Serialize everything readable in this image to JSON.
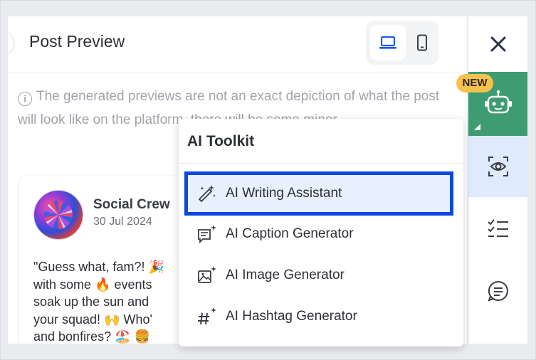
{
  "panel": {
    "title": "Post Preview",
    "notice": "The generated previews are not an exact depiction of what the post will look like on the platform, there will be some minor"
  },
  "post": {
    "account_name": "Social Crew",
    "date": "30 Jul 2024",
    "lines": [
      "\"Guess what, fam?! 🎉",
      "with some 🔥 events",
      "soak up the sun and",
      "your squad! 🙌 Who'",
      "and bonfires? 🏖️ 🍔"
    ]
  },
  "sidebar": {
    "badge": "NEW"
  },
  "menu": {
    "title": "AI Toolkit",
    "items": [
      {
        "label": "AI Writing Assistant",
        "icon": "magic-wand-icon",
        "active": true
      },
      {
        "label": "AI Caption Generator",
        "icon": "caption-sparkle-icon",
        "active": false
      },
      {
        "label": "AI Image Generator",
        "icon": "image-sparkle-icon",
        "active": false
      },
      {
        "label": "AI Hashtag Generator",
        "icon": "hashtag-sparkle-icon",
        "active": false
      }
    ]
  },
  "colors": {
    "accent": "#0b48e0",
    "brand_green": "#3e9b72",
    "badge": "#f6c24d",
    "active_tile": "#dfeafd"
  }
}
